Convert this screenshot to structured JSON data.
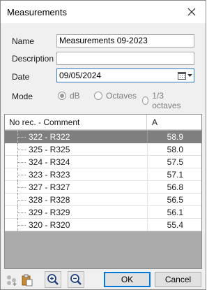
{
  "window": {
    "title": "Measurements"
  },
  "form": {
    "name_label": "Name",
    "name_value": "Measurements 09-2023",
    "description_label": "Description",
    "description_value": "",
    "date_label": "Date",
    "date_value": "09/05/2024",
    "mode_label": "Mode",
    "mode_options": [
      "dB",
      "Octaves",
      "1/3 octaves"
    ],
    "mode_selected": "dB"
  },
  "grid": {
    "columns": [
      "No rec. - Comment",
      "A"
    ],
    "rows": [
      {
        "comment": "322 - R322",
        "a": "58.9",
        "selected": true
      },
      {
        "comment": "325 - R325",
        "a": "58.0"
      },
      {
        "comment": "324 - R324",
        "a": "57.5"
      },
      {
        "comment": "323 - R323",
        "a": "57.1"
      },
      {
        "comment": "327 - R327",
        "a": "56.8"
      },
      {
        "comment": "328 - R328",
        "a": "56.5"
      },
      {
        "comment": "329 - R329",
        "a": "56.1"
      },
      {
        "comment": "320 - R320",
        "a": "55.4"
      }
    ]
  },
  "footer": {
    "ok_label": "OK",
    "cancel_label": "Cancel",
    "icons": [
      "add-icon",
      "paste-icon",
      "zoom-in-icon",
      "zoom-out-icon"
    ]
  },
  "colors": {
    "selected_row": "#7f7f7f",
    "focus_border": "#0078d7",
    "grid_empty": "#ababab"
  }
}
